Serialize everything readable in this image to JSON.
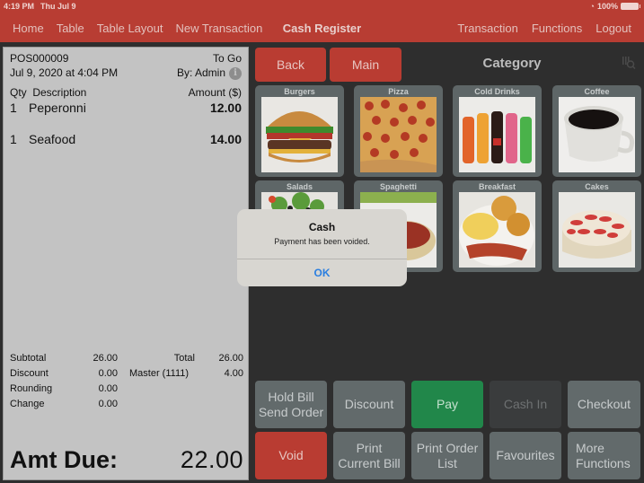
{
  "status_bar": {
    "time": "4:19 PM",
    "date": "Thu Jul 9",
    "battery": "100%"
  },
  "nav": {
    "left": [
      "Home",
      "Table",
      "Table Layout",
      "New Transaction"
    ],
    "title": "Cash Register",
    "right": [
      "Transaction",
      "Functions",
      "Logout"
    ]
  },
  "receipt": {
    "order_no": "POS000009",
    "order_type": "To Go",
    "datetime": "Jul 9, 2020 at 4:04 PM",
    "by": "By: Admin",
    "headers": {
      "qty_desc": "Qty  Description",
      "amount": "Amount ($)"
    },
    "items": [
      {
        "qty": "1",
        "desc": "Peperonni",
        "amount": "12.00"
      },
      {
        "qty": "1",
        "desc": "Seafood",
        "amount": "14.00"
      }
    ],
    "totals": {
      "subtotal_label": "Subtotal",
      "subtotal": "26.00",
      "discount_label": "Discount",
      "discount": "0.00",
      "rounding_label": "Rounding",
      "rounding": "0.00",
      "change_label": "Change",
      "change": "0.00",
      "total_label": "Total",
      "total": "26.00",
      "payment_label": "Master (1111)",
      "payment": "4.00"
    },
    "amt_due_label": "Amt Due:",
    "amt_due": "22.00"
  },
  "panel": {
    "back": "Back",
    "main": "Main",
    "category_title": "Category",
    "categories": [
      "Burgers",
      "Pizza",
      "Cold Drinks",
      "Coffee",
      "Salads",
      "Spaghetti",
      "Breakfast",
      "Cakes"
    ]
  },
  "actions": {
    "row1": [
      "Hold Bill\nSend Order",
      "Discount",
      "Pay",
      "Cash In",
      "Checkout"
    ],
    "row2": [
      "Void",
      "Print\nCurrent Bill",
      "Print Order\nList",
      "Favourites",
      "More\nFunctions"
    ]
  },
  "alert": {
    "title": "Cash",
    "message": "Payment has been voided.",
    "ok": "OK"
  },
  "colors": {
    "brand_red": "#b83d33",
    "pay_green": "#21874a",
    "link_blue": "#2b7fe0"
  }
}
